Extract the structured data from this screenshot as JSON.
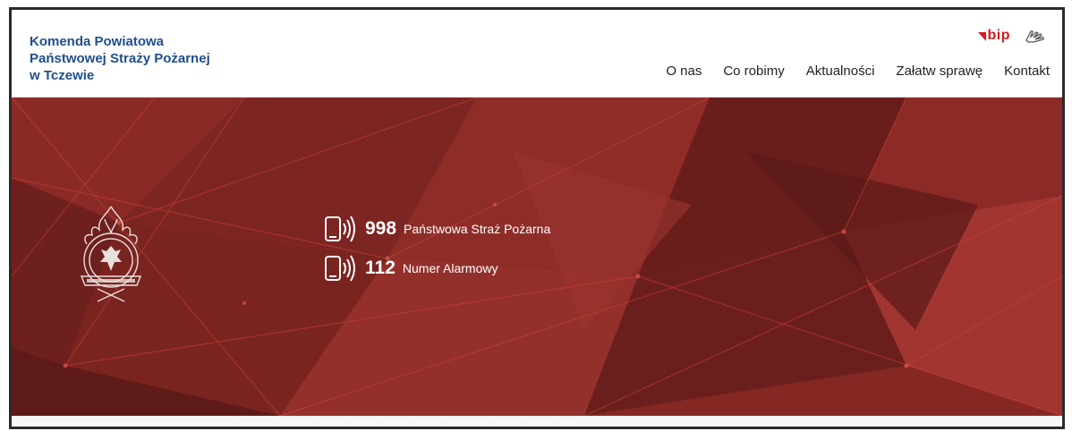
{
  "header": {
    "org_name": "Komenda Powiatowa\nPaństwowej Straży Pożarnej\nw Tczewie",
    "bip_label": "bip",
    "sign_language_icon": "sign-language-icon",
    "colors": {
      "org_name": "#1f4e8c",
      "bip": "#d71a20"
    }
  },
  "nav": {
    "items": [
      {
        "label": "O nas"
      },
      {
        "label": "Co robimy"
      },
      {
        "label": "Aktualności"
      },
      {
        "label": "Załatw sprawę"
      },
      {
        "label": "Kontakt"
      }
    ]
  },
  "hero": {
    "emblem_icon": "fire-service-emblem-icon",
    "phones": [
      {
        "number": "998",
        "label": "Państwowa Straż Pożarna",
        "icon": "phone-icon"
      },
      {
        "number": "112",
        "label": "Numer Alarmowy",
        "icon": "phone-icon"
      }
    ],
    "colors": {
      "background": "#7a2320",
      "text": "#ffffff"
    }
  }
}
